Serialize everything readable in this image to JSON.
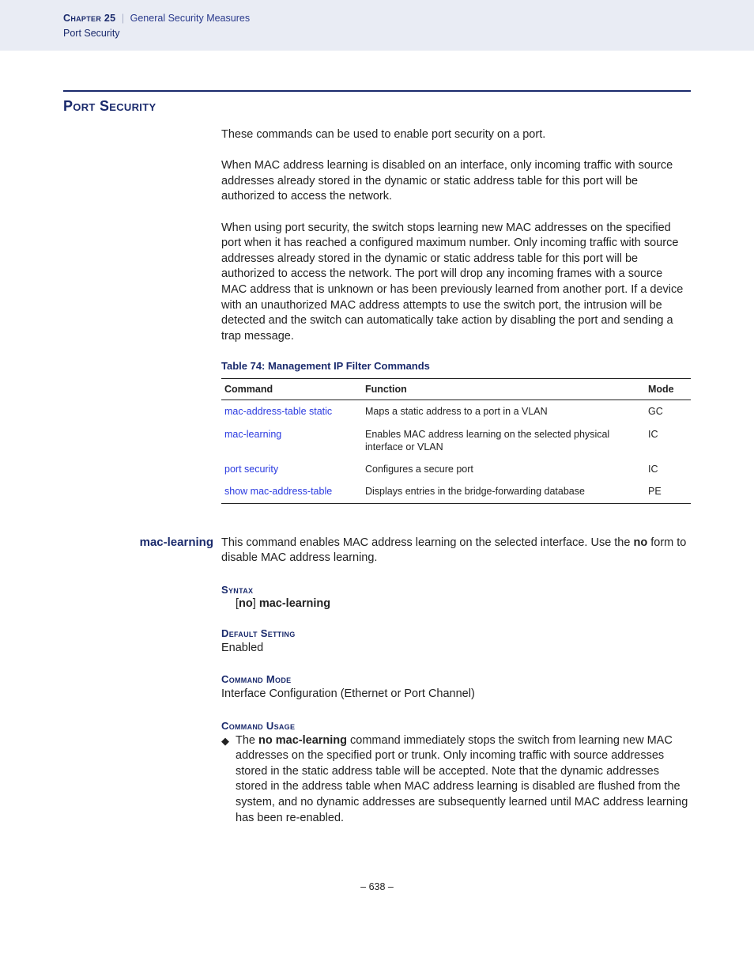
{
  "header": {
    "chapter_label": "Chapter 25",
    "separator": "|",
    "title": "General Security Measures",
    "subtitle": "Port Security"
  },
  "section": {
    "heading": "Port Security",
    "p1": "These commands can be used to enable port security on a port.",
    "p2": "When MAC address learning is disabled on an interface, only incoming traffic with source addresses already stored in the dynamic or static address table for this port will be authorized to access the network.",
    "p3": "When using port security, the switch stops learning new MAC addresses on the specified port when it has reached a configured maximum number. Only incoming traffic with source addresses already stored in the dynamic or static address table for this port will be authorized to access the network. The port will drop any incoming frames with a source MAC address that is unknown or has been previously learned from another port. If a device with an unauthorized MAC address attempts to use the switch port, the intrusion will be detected and the switch can automatically take action by disabling the port and sending a trap message."
  },
  "table": {
    "caption": "Table 74: Management IP Filter Commands",
    "headers": {
      "c1": "Command",
      "c2": "Function",
      "c3": "Mode"
    },
    "rows": [
      {
        "cmd": "mac-address-table static",
        "func": "Maps a static address to a port in a VLAN",
        "mode": "GC"
      },
      {
        "cmd": "mac-learning",
        "func": "Enables MAC address learning on the selected physical interface or VLAN",
        "mode": "IC"
      },
      {
        "cmd": "port security",
        "func": "Configures a secure port",
        "mode": "IC"
      },
      {
        "cmd": "show mac-address-table",
        "func": "Displays entries in the bridge-forwarding database",
        "mode": "PE"
      }
    ]
  },
  "detail": {
    "side_label": "mac-learning",
    "intro_pre": "This command enables MAC address learning on the selected interface. Use the ",
    "intro_bold": "no",
    "intro_post": " form to disable MAC address learning.",
    "syntax_label": "Syntax",
    "syntax_lbracket": "[",
    "syntax_no": "no",
    "syntax_rbracket": "] ",
    "syntax_cmd": "mac-learning",
    "default_label": "Default Setting",
    "default_value": "Enabled",
    "mode_label": "Command Mode",
    "mode_value": "Interface Configuration (Ethernet or Port Channel)",
    "usage_label": "Command Usage",
    "bullet_glyph": "◆",
    "usage_pre": "The ",
    "usage_bold": "no mac-learning",
    "usage_post": " command immediately stops the switch from learning new MAC addresses on the specified port or trunk. Only incoming traffic with source addresses stored in the static address table will be accepted. Note that the dynamic addresses stored in the address table when MAC address learning is disabled are flushed from the system, and no dynamic addresses are subsequently learned until MAC address learning has been re-enabled."
  },
  "pagenum": "–  638  –"
}
